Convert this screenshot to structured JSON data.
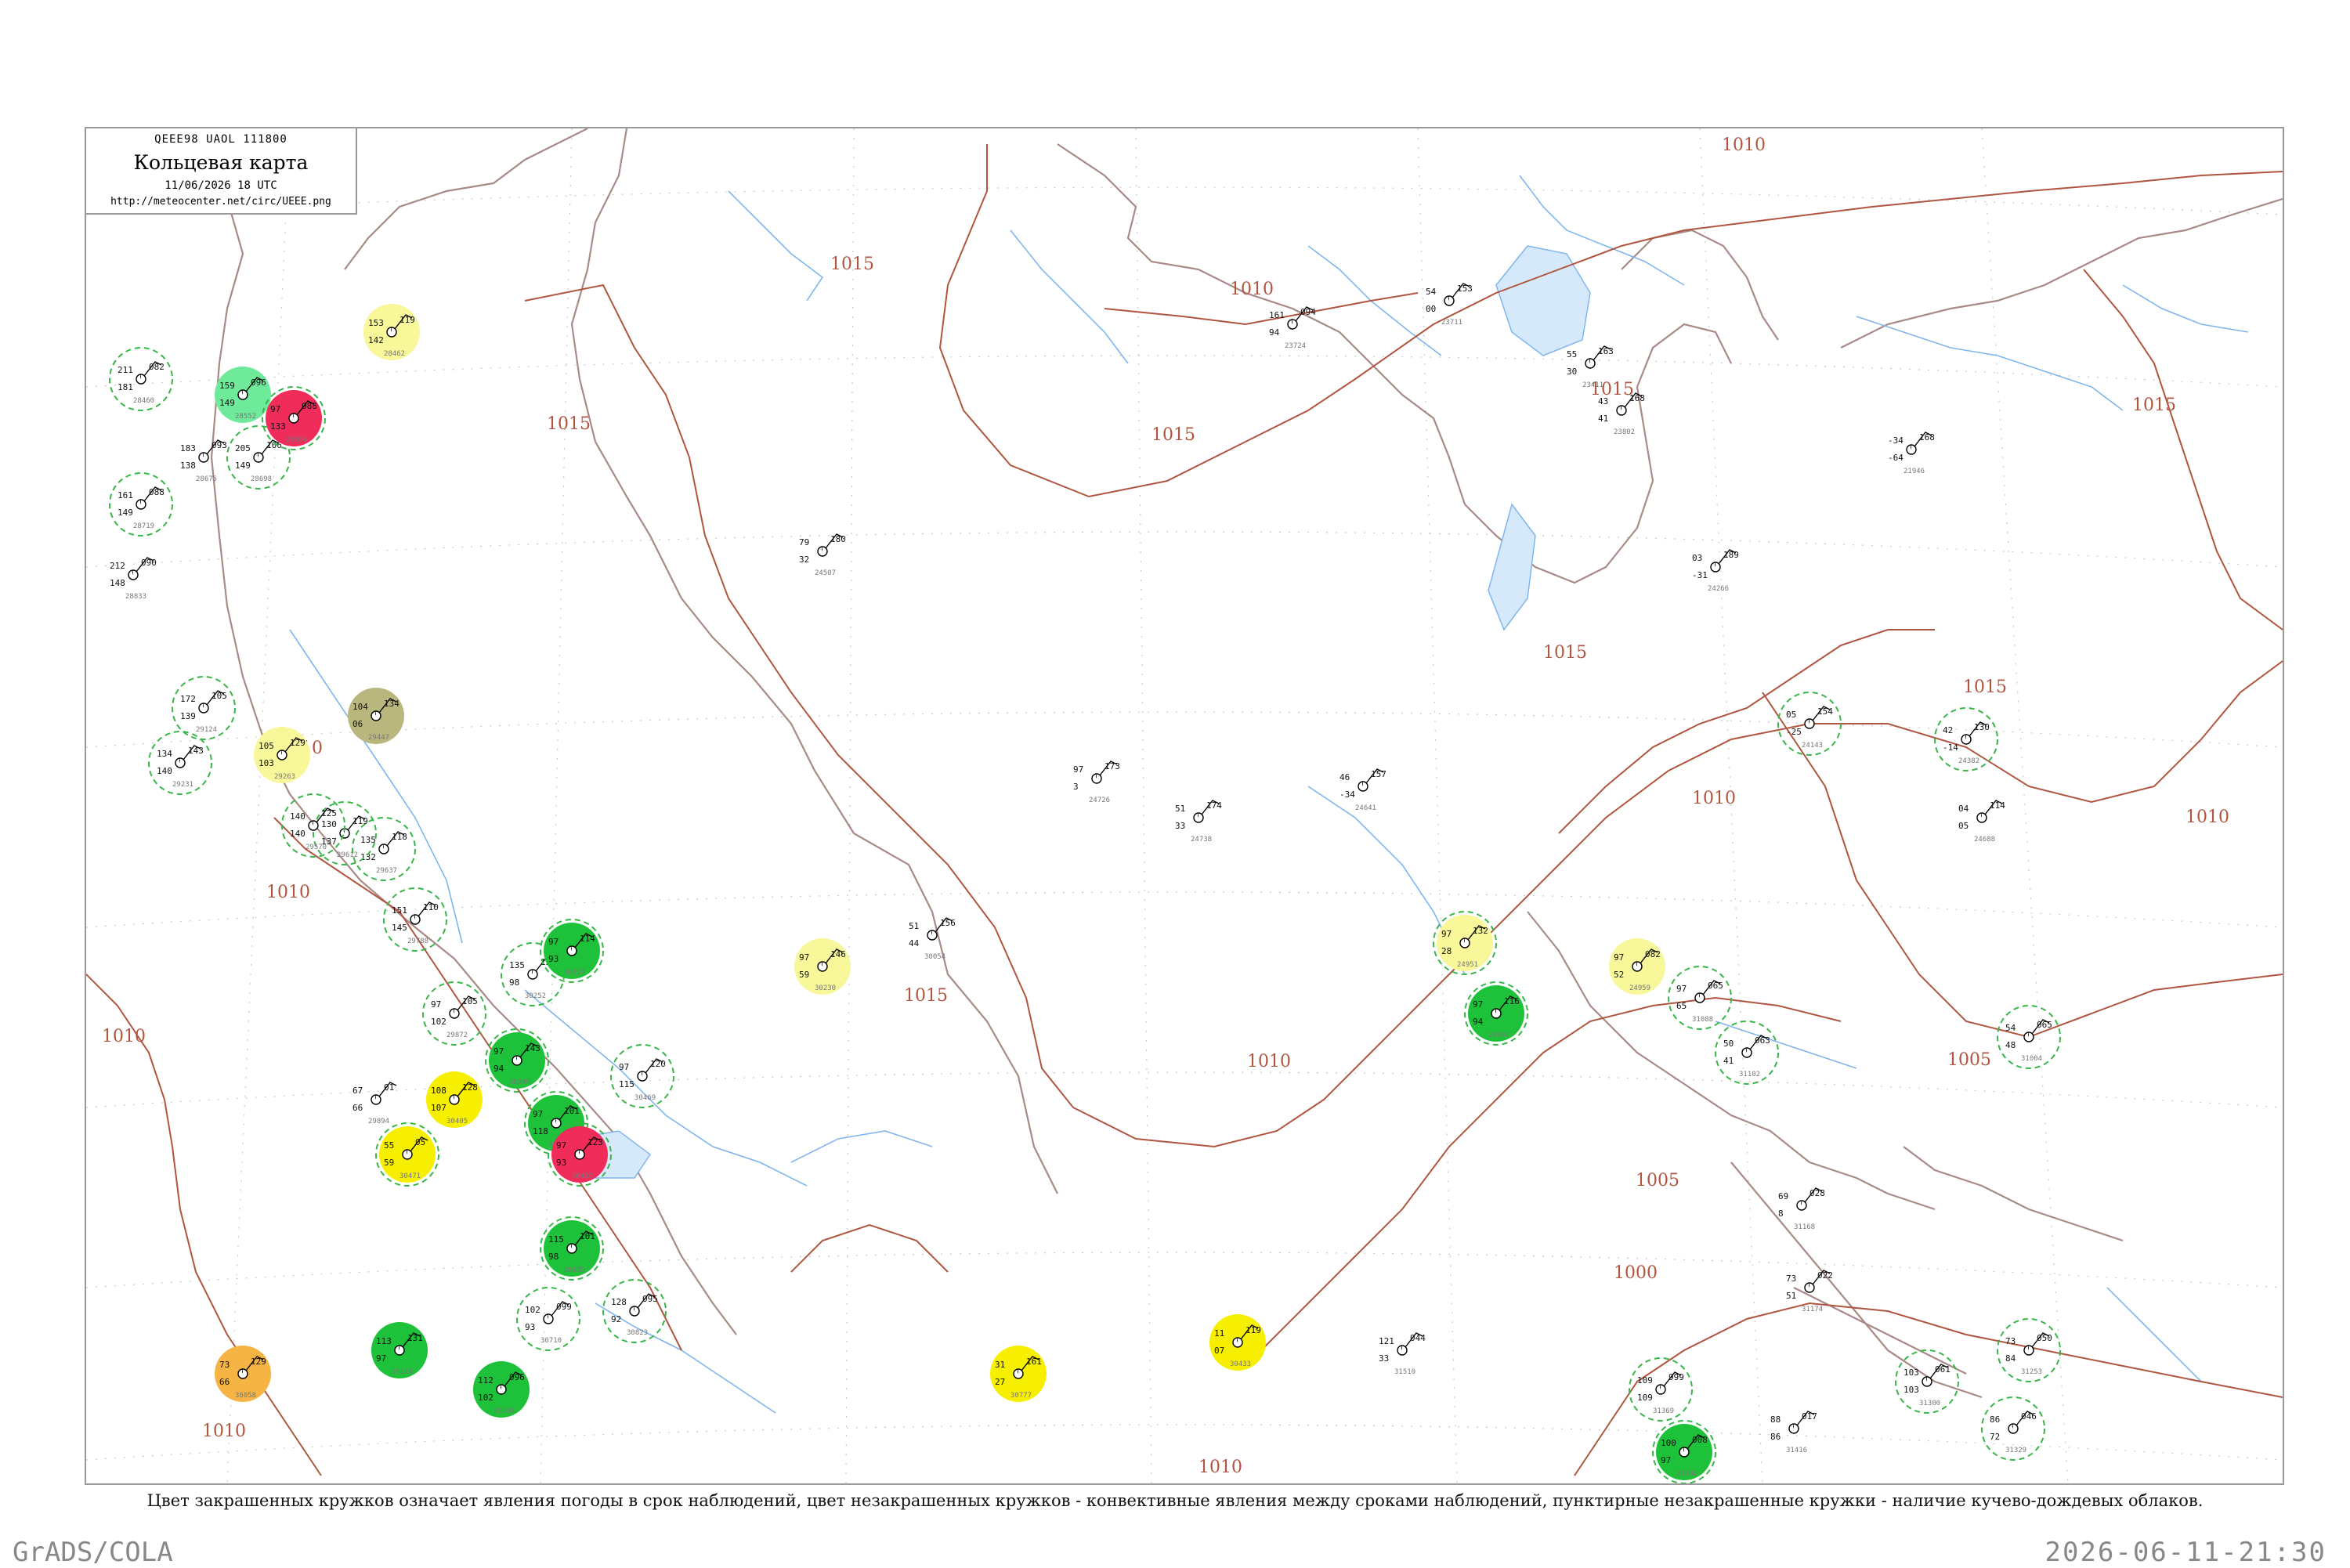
{
  "header": {
    "code": "QEEE98  UAOL  111800",
    "title": "Кольцевая карта",
    "date": "11/06/2026 18 UTC",
    "url": "http://meteocenter.net/circ/UEEE.png"
  },
  "caption": "Цвет закрашенных кружков означает явления погоды в срок наблюдений, цвет незакрашенных кружков - конвективные явления между сроками наблюдений, пунктирные незакрашенные кружки - наличие кучево-дождевых облаков.",
  "footer": {
    "left": "GrADS/COLA",
    "right": "2026-06-11-21:30"
  },
  "colors": {
    "isobar": "#b0553f",
    "coast": "#a88a86",
    "river": "#7fb6ee",
    "cb_dashed": "#39b54a",
    "convective_ring": "#d9306b",
    "fill_green": "#1ec23a",
    "fill_light_green": "#6fe99a",
    "fill_red": "#ef2c5a",
    "fill_yellow": "#f6f000",
    "fill_light_yellow": "#f8f79a",
    "fill_orange": "#f5b443",
    "fill_olive": "#b9b77e"
  },
  "isobar_labels": [
    {
      "text": "1010"
    },
    {
      "text": "1015"
    },
    {
      "text": "1010"
    },
    {
      "text": "1015"
    },
    {
      "text": "1015"
    },
    {
      "text": "1015"
    },
    {
      "text": "1015"
    },
    {
      "text": "1015"
    },
    {
      "text": "1015"
    },
    {
      "text": "1015"
    },
    {
      "text": "1010"
    },
    {
      "text": "1010"
    },
    {
      "text": "1010"
    },
    {
      "text": "1010"
    },
    {
      "text": "1010"
    },
    {
      "text": "1010"
    },
    {
      "text": "1005"
    },
    {
      "text": "1005"
    },
    {
      "text": "1000"
    },
    {
      "text": "1010"
    },
    {
      "text": "1010"
    }
  ],
  "stations": [
    {
      "id": "24143",
      "pressure": "154",
      "temp": "05",
      "dew": "-25",
      "fill": "none",
      "cb": true
    },
    {
      "id": "24382",
      "pressure": "130",
      "temp": "42",
      "dew": "-14",
      "fill": "none",
      "cb": true
    },
    {
      "id": "24688",
      "pressure": "114",
      "temp": "04",
      "dew": "05",
      "fill": "none",
      "cb": false
    },
    {
      "id": "24266",
      "pressure": "189",
      "temp": "03",
      "dew": "-31",
      "fill": "none",
      "cb": false
    },
    {
      "id": "24507",
      "pressure": "180",
      "temp": "79",
      "dew": "32",
      "fill": "none",
      "cb": false
    },
    {
      "id": "24641",
      "pressure": "157",
      "temp": "46",
      "dew": "-34",
      "fill": "none",
      "cb": false
    },
    {
      "id": "24738",
      "pressure": "174",
      "temp": "51",
      "dew": "33",
      "fill": "none",
      "cb": false
    },
    {
      "id": "24726",
      "pressure": "173",
      "temp": "97",
      "dew": "3",
      "fill": "none",
      "cb": false
    },
    {
      "id": "24959",
      "pressure": "082",
      "temp": "97",
      "dew": "52",
      "fill": "light_yellow",
      "cb": false
    },
    {
      "id": "24944",
      "pressure": "116",
      "temp": "97",
      "dew": "94",
      "fill": "green",
      "cb": true
    },
    {
      "id": "24951",
      "pressure": "132",
      "temp": "97",
      "dew": "28",
      "fill": "light_yellow",
      "cb": true
    },
    {
      "id": "30054",
      "pressure": "156",
      "temp": "51",
      "dew": "44",
      "fill": "none",
      "cb": false
    },
    {
      "id": "30230",
      "pressure": "146",
      "temp": "97",
      "dew": "59",
      "fill": "light_yellow",
      "cb": false
    },
    {
      "id": "30433",
      "pressure": "119",
      "temp": "11",
      "dew": "07",
      "fill": "yellow",
      "cb": false
    },
    {
      "id": "30777",
      "pressure": "161",
      "temp": "31",
      "dew": "27",
      "fill": "yellow",
      "cb": false
    },
    {
      "id": "31004",
      "pressure": "065",
      "temp": "54",
      "dew": "48",
      "fill": "none",
      "cb": true
    },
    {
      "id": "31102",
      "pressure": "063",
      "temp": "50",
      "dew": "41",
      "fill": "none",
      "cb": true
    },
    {
      "id": "31088",
      "pressure": "065",
      "temp": "97",
      "dew": "65",
      "fill": "none",
      "cb": true
    },
    {
      "id": "31168",
      "pressure": "028",
      "temp": "69",
      "dew": "8",
      "fill": "none",
      "cb": false
    },
    {
      "id": "31174",
      "pressure": "022",
      "temp": "73",
      "dew": "51",
      "fill": "none",
      "cb": false
    },
    {
      "id": "31253",
      "pressure": "050",
      "temp": "73",
      "dew": "84",
      "fill": "none",
      "cb": true
    },
    {
      "id": "31300",
      "pressure": "061",
      "temp": "103",
      "dew": "103",
      "fill": "none",
      "cb": true
    },
    {
      "id": "31329",
      "pressure": "046",
      "temp": "86",
      "dew": "72",
      "fill": "none",
      "cb": true
    },
    {
      "id": "31510",
      "pressure": "044",
      "temp": "121",
      "dew": "33",
      "fill": "none",
      "cb": false
    },
    {
      "id": "31369",
      "pressure": "999",
      "temp": "109",
      "dew": "109",
      "fill": "none",
      "cb": true
    },
    {
      "id": "31388",
      "pressure": "008",
      "temp": "100",
      "dew": "97",
      "fill": "green",
      "cb": true
    },
    {
      "id": "31416",
      "pressure": "017",
      "temp": "88",
      "dew": "86",
      "fill": "none",
      "cb": false
    },
    {
      "id": "30823",
      "pressure": "095",
      "temp": "128",
      "dew": "92",
      "fill": "none",
      "cb": true
    },
    {
      "id": "30710",
      "pressure": "099",
      "temp": "102",
      "dew": "93",
      "fill": "none",
      "cb": true
    },
    {
      "id": "30635",
      "pressure": "101",
      "temp": "115",
      "dew": "98",
      "fill": "green",
      "cb": true
    },
    {
      "id": "30521",
      "pressure": "101",
      "temp": "97",
      "dew": "118",
      "fill": "green",
      "cb": true
    },
    {
      "id": "30455",
      "pressure": "123",
      "temp": "97",
      "dew": "93",
      "fill": "red",
      "cb": true
    },
    {
      "id": "30469",
      "pressure": "120",
      "temp": "97",
      "dew": "115",
      "fill": "none",
      "cb": true
    },
    {
      "id": "30309",
      "pressure": "143",
      "temp": "97",
      "dew": "94",
      "fill": "green",
      "cb": true
    },
    {
      "id": "30252",
      "pressure": "120",
      "temp": "135",
      "dew": "98",
      "fill": "none",
      "cb": true
    },
    {
      "id": "30337",
      "pressure": "114",
      "temp": "97",
      "dew": "93",
      "fill": "green",
      "cb": true
    },
    {
      "id": "30405",
      "pressure": "128",
      "temp": "108",
      "dew": "107",
      "fill": "yellow",
      "cb": false
    },
    {
      "id": "30471",
      "pressure": "05",
      "temp": "55",
      "dew": "59",
      "fill": "yellow",
      "cb": true
    },
    {
      "id": "29894",
      "pressure": "01",
      "temp": "67",
      "dew": "66",
      "fill": "none",
      "cb": false
    },
    {
      "id": "29872",
      "pressure": "105",
      "temp": "97",
      "dew": "102",
      "fill": "none",
      "cb": true
    },
    {
      "id": "29788",
      "pressure": "110",
      "temp": "151",
      "dew": "145",
      "fill": "none",
      "cb": true
    },
    {
      "id": "29637",
      "pressure": "118",
      "temp": "135",
      "dew": "132",
      "fill": "none",
      "cb": true
    },
    {
      "id": "29612",
      "pressure": "119",
      "temp": "130",
      "dew": "137",
      "fill": "none",
      "cb": true
    },
    {
      "id": "29570",
      "pressure": "125",
      "temp": "140",
      "dew": "140",
      "fill": "none",
      "cb": true
    },
    {
      "id": "29447",
      "pressure": "134",
      "temp": "104",
      "dew": "06",
      "fill": "olive",
      "cb": false
    },
    {
      "id": "29263",
      "pressure": "129",
      "temp": "105",
      "dew": "103",
      "fill": "light_yellow",
      "cb": false
    },
    {
      "id": "29231",
      "pressure": "143",
      "temp": "134",
      "dew": "140",
      "fill": "none",
      "cb": true
    },
    {
      "id": "29124",
      "pressure": "105",
      "temp": "172",
      "dew": "139",
      "fill": "none",
      "cb": true
    },
    {
      "id": "28833",
      "pressure": "090",
      "temp": "212",
      "dew": "148",
      "fill": "none",
      "cb": false
    },
    {
      "id": "28719",
      "pressure": "088",
      "temp": "161",
      "dew": "149",
      "fill": "none",
      "cb": true
    },
    {
      "id": "28675",
      "pressure": "093",
      "temp": "183",
      "dew": "138",
      "fill": "none",
      "cb": false
    },
    {
      "id": "28698",
      "pressure": "106",
      "temp": "205",
      "dew": "149",
      "fill": "none",
      "cb": true
    },
    {
      "id": "28552",
      "pressure": "096",
      "temp": "159",
      "dew": "149",
      "fill": "light_green",
      "cb": false
    },
    {
      "id": "28696",
      "pressure": "088",
      "temp": "97",
      "dew": "133",
      "fill": "red",
      "cb": true
    },
    {
      "id": "28460",
      "pressure": "082",
      "temp": "211",
      "dew": "181",
      "fill": "none",
      "cb": true
    },
    {
      "id": "28462",
      "pressure": "119",
      "temp": "153",
      "dew": "142",
      "fill": "light_yellow",
      "cb": false
    },
    {
      "id": "23724",
      "pressure": "094",
      "temp": "161",
      "dew": "94",
      "fill": "none",
      "cb": false
    },
    {
      "id": "36058",
      "pressure": "129",
      "temp": "73",
      "dew": "66",
      "fill": "orange",
      "cb": false
    },
    {
      "id": "35121",
      "pressure": "131",
      "temp": "113",
      "dew": "97",
      "fill": "green",
      "cb": false
    },
    {
      "id": "35188",
      "pressure": "096",
      "temp": "112",
      "dew": "102",
      "fill": "green",
      "cb": false
    },
    {
      "id": "23411",
      "pressure": "163",
      "temp": "55",
      "dew": "30",
      "fill": "none",
      "cb": false
    },
    {
      "id": "23802",
      "pressure": "168",
      "temp": "43",
      "dew": "41",
      "fill": "none",
      "cb": false
    },
    {
      "id": "23711",
      "pressure": "153",
      "temp": "54",
      "dew": "00",
      "fill": "none",
      "cb": false
    },
    {
      "id": "21946",
      "pressure": "168",
      "temp": "-34",
      "dew": "-64",
      "fill": "none",
      "cb": false
    }
  ]
}
